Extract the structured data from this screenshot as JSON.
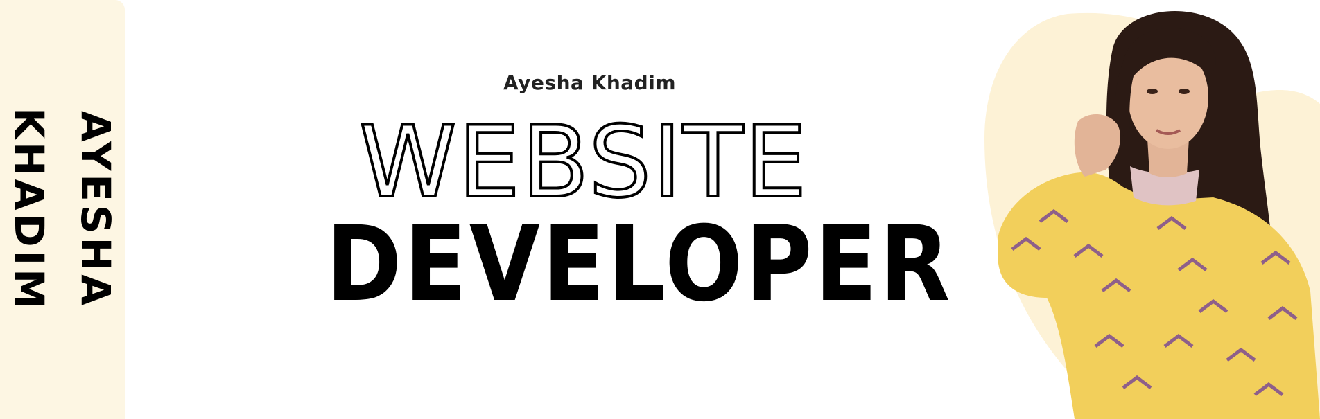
{
  "side_label": {
    "lines": [
      "AYESHA",
      "KHADIM"
    ]
  },
  "headline": {
    "name": "Ayesha Khadim",
    "outline_word": "WEBSITE",
    "bold_word": "DEVELOPER"
  },
  "colors": {
    "strip_bg": "#fdf6e3",
    "portrait_bg": "#fdf2d6",
    "shirt": "#f2cf5b",
    "pattern": "#8e5f8a",
    "hair": "#2b1a14",
    "skin": "#e2b497"
  },
  "portrait": {
    "icon": "person-photo"
  }
}
